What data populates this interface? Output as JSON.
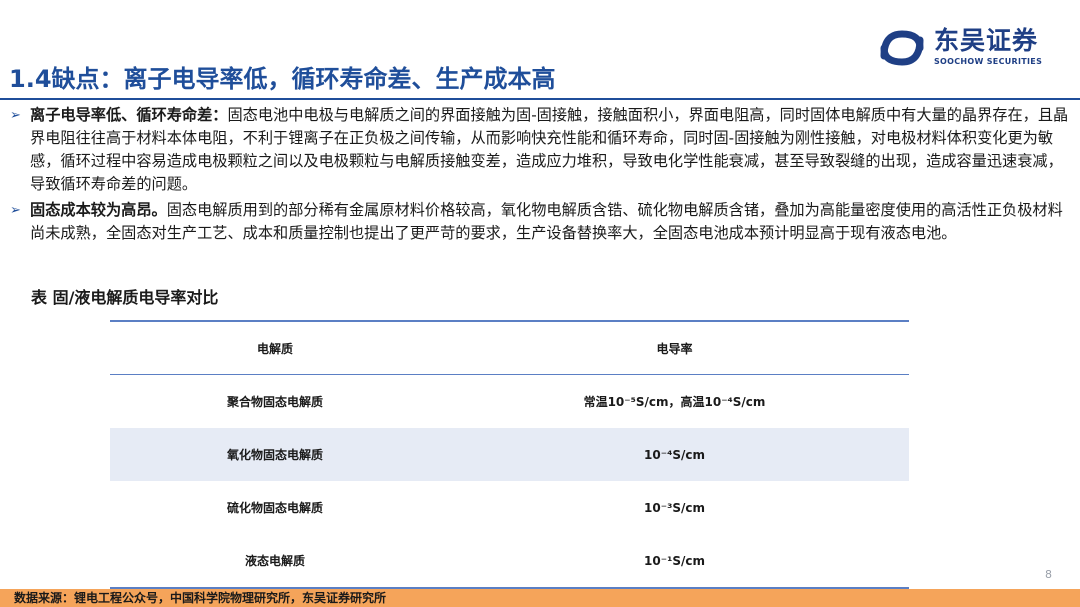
{
  "brand": {
    "name_cn": "东吴证券",
    "name_en": "SOOCHOW SECURITIES",
    "color": "#1f3f85"
  },
  "title": "1.4缺点：离子电导率低，循环寿命差、生产成本高",
  "bullets": [
    {
      "lead": "离子电导率低、循环寿命差：",
      "text": "固态电池中电极与电解质之间的界面接触为固-固接触，接触面积小，界面电阻高，同时固体电解质中有大量的晶界存在，且晶界电阻往往高于材料本体电阻，不利于锂离子在正负极之间传输，从而影响快充性能和循环寿命，同时固-固接触为刚性接触，对电极材料体积变化更为敏感，循环过程中容易造成电极颗粒之间以及电极颗粒与电解质接触变差，造成应力堆积，导致电化学性能衰减，甚至导致裂缝的出现，造成容量迅速衰减，导致循环寿命差的问题。"
    },
    {
      "lead": "固态成本较为高昂。",
      "text": "固态电解质用到的部分稀有金属原材料价格较高，氧化物电解质含锆、硫化物电解质含锗，叠加为高能量密度使用的高活性正负极材料尚未成熟，全固态对生产工艺、成本和质量控制也提出了更严苛的要求，生产设备替换率大，全固态电池成本预计明显高于现有液态电池。"
    }
  ],
  "table": {
    "caption": "表 固/液电解质电导率对比",
    "headers": [
      "电解质",
      "电导率"
    ],
    "rows": [
      {
        "name": "聚合物固态电解质",
        "conductivity": "常温10⁻⁵S/cm，高温10⁻⁴S/cm"
      },
      {
        "name": "氧化物固态电解质",
        "conductivity": "10⁻⁴S/cm"
      },
      {
        "name": "硫化物固态电解质",
        "conductivity": "10⁻³S/cm"
      },
      {
        "name": "液态电解质",
        "conductivity": "10⁻¹S/cm"
      }
    ]
  },
  "page_number": "8",
  "source": "数据来源：锂电工程公众号，中国科学院物理研究所，东吴证券研究所",
  "colors": {
    "title": "#1f4e9a",
    "table_rule": "#5b7fc4",
    "row_highlight": "#e6ebf5",
    "footer": "#f5a45a"
  }
}
